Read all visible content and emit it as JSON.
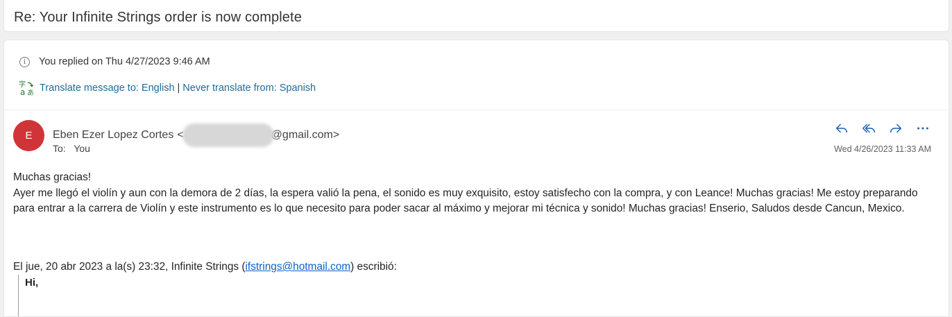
{
  "subject": "Re: Your Infinite Strings order is now complete",
  "info": {
    "replied": "You replied on Thu 4/27/2023 9:46 AM",
    "translate_link": "Translate message to: English",
    "separator": "|",
    "never_translate_link": "Never translate from: Spanish"
  },
  "sender": {
    "initial": "E",
    "avatar_color": "#d13438",
    "name": "Eben Ezer Lopez Cortes",
    "email_prefix": "<",
    "email_suffix": "@gmail.com>",
    "to_label": "To:",
    "to_value": "You",
    "date": "Wed 4/26/2023 11:33 AM"
  },
  "actions": [
    "reply-icon",
    "reply-all-icon",
    "forward-icon",
    "more-icon"
  ],
  "body": {
    "line1": "Muchas gracias!",
    "line2": "Ayer me llegó el violín y aun con la demora de 2 días, la espera valió la pena, el sonido es muy exquisito, estoy satisfecho con la compra, y con Leance! Muchas gracias! Me estoy preparando para entrar a la carrera de Violín y este instrumento es lo que necesito para poder sacar al máximo y mejorar mi técnica y sonido! Muchas gracias! Enserio, Saludos desde Cancun, Mexico."
  },
  "quote": {
    "intro_before": "El jue, 20 abr 2023 a la(s) 23:32, Infinite Strings (",
    "email": "ifstrings@hotmail.com",
    "intro_after": ") escribió:",
    "greeting": "Hi,"
  }
}
